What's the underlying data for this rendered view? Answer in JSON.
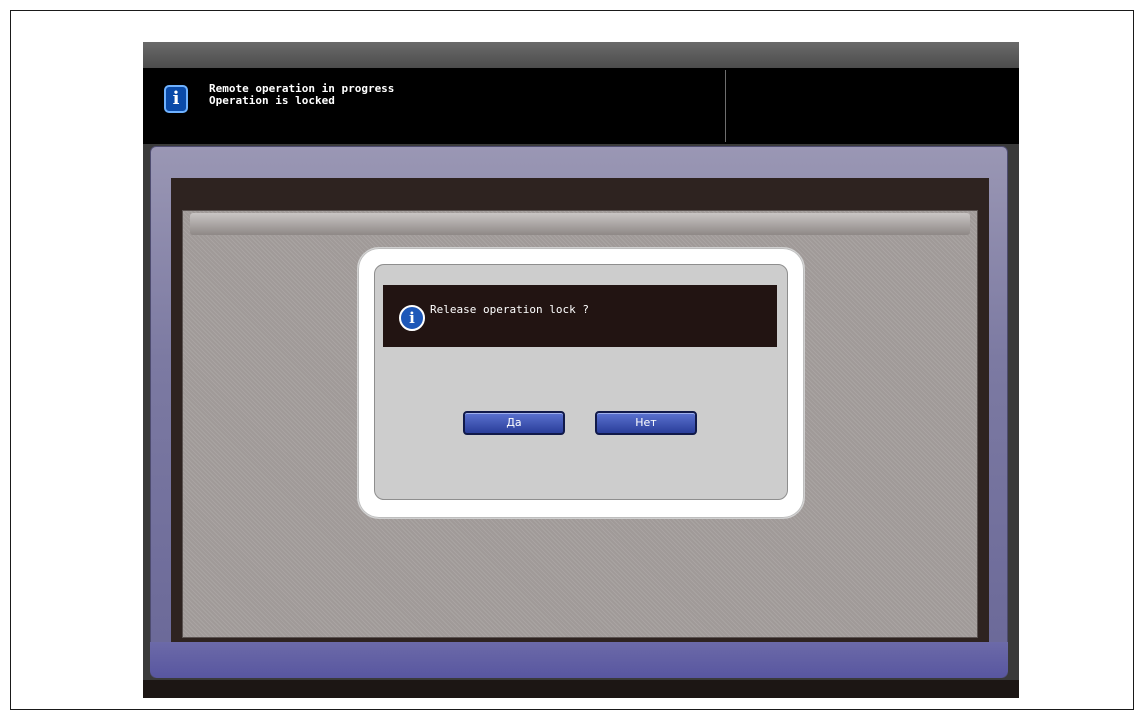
{
  "status_bar": {
    "icon": "info-icon",
    "line1": "Remote operation in progress",
    "line2": "Operation is locked"
  },
  "dialog": {
    "icon": "info-icon",
    "message": "Release operation lock ?",
    "yes_label": "Да",
    "no_label": "Нет"
  },
  "colors": {
    "button_blue": "#3a50b4",
    "frame_purple": "#7c7aa2",
    "info_blue": "#1e58b8"
  }
}
